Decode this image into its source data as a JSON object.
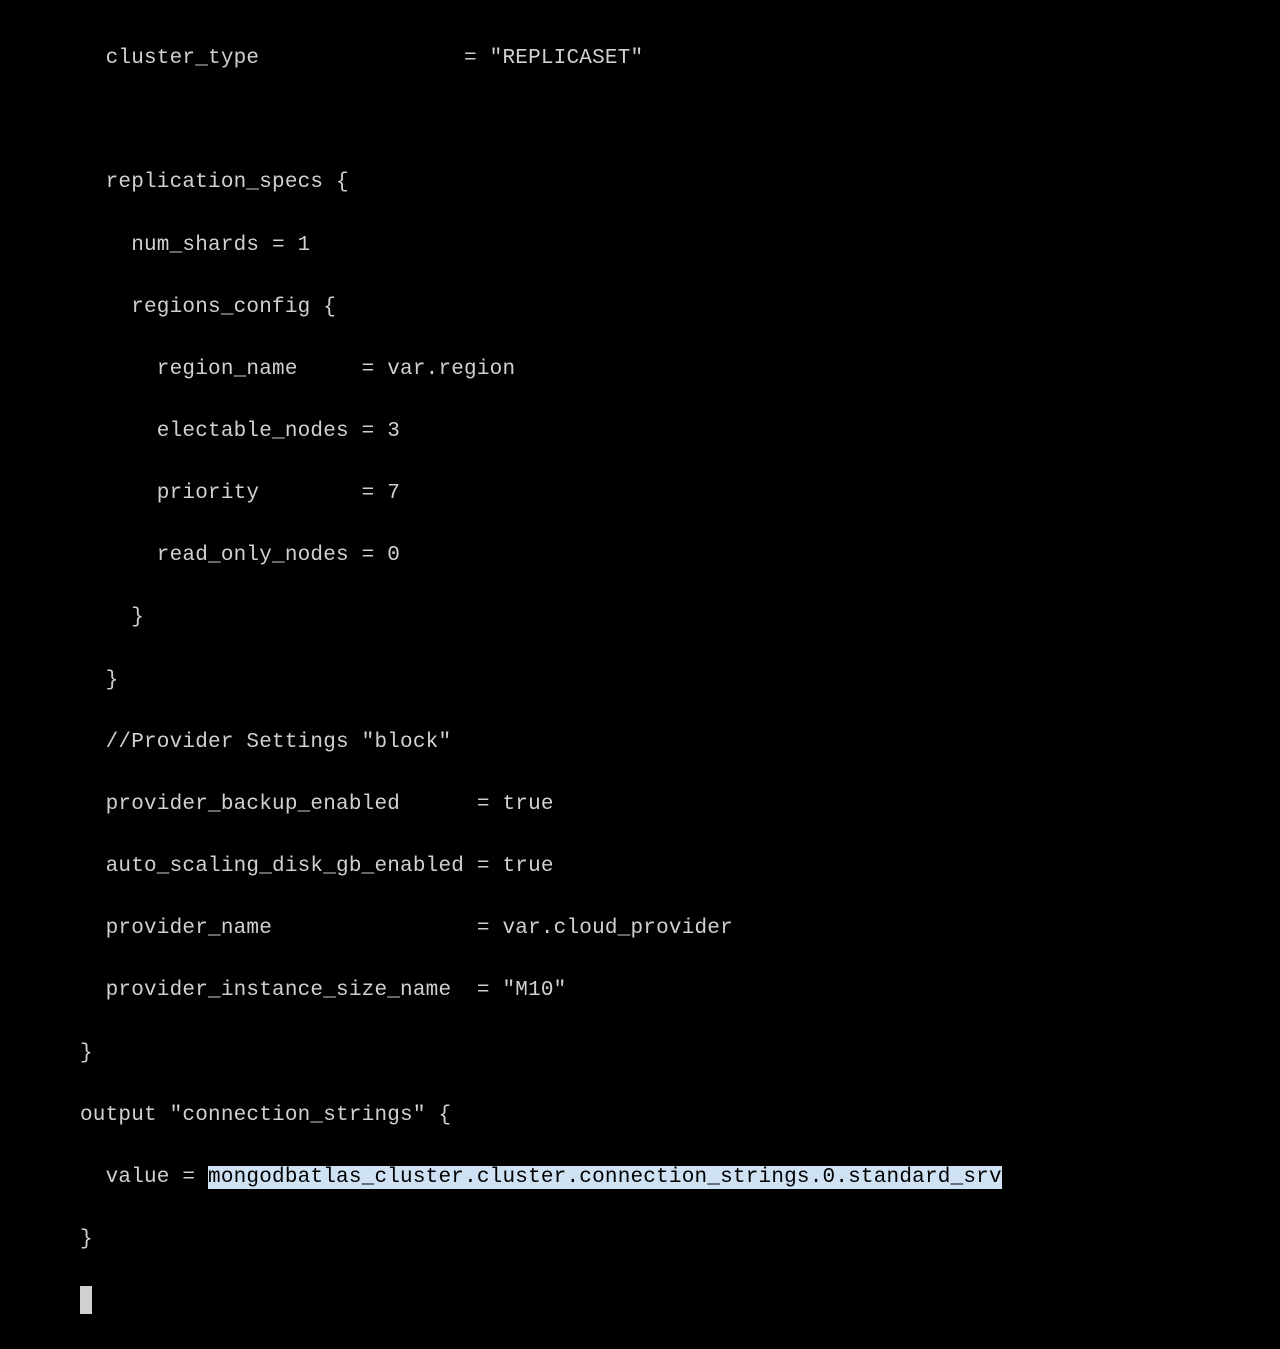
{
  "code": {
    "l01": "  cluster_type                = \"REPLICASET\"",
    "l02": "",
    "l03": "  replication_specs {",
    "l04": "    num_shards = 1",
    "l05": "    regions_config {",
    "l06": "      region_name     = var.region",
    "l07": "      electable_nodes = 3",
    "l08": "      priority        = 7",
    "l09": "      read_only_nodes = 0",
    "l10": "    }",
    "l11": "  }",
    "l12": "  //Provider Settings \"block\"",
    "l13": "  provider_backup_enabled      = true",
    "l14": "  auto_scaling_disk_gb_enabled = true",
    "l15": "  provider_name                = var.cloud_provider",
    "l16": "  provider_instance_size_name  = \"M10\"",
    "l17": "}",
    "l18": "output \"connection_strings\" {",
    "l19_prefix": "  value = ",
    "l19_highlight": "mongodbatlas_cluster.cluster.connection_strings.0.standard_srv",
    "l20": "}"
  }
}
